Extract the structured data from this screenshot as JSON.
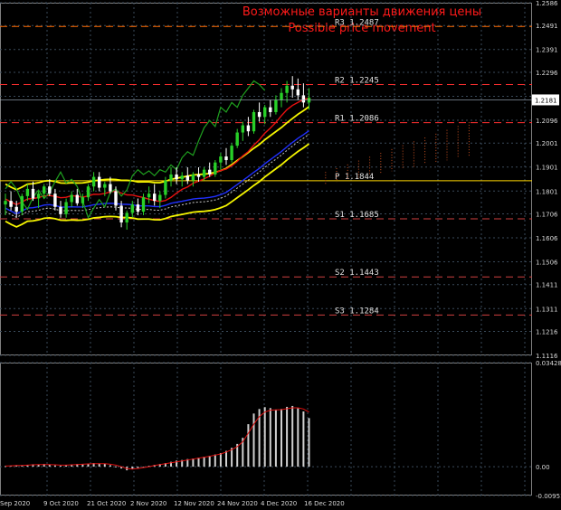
{
  "chart_data": {
    "type": "candlestick",
    "title": "Возможные варианты движения цены",
    "subtitle": "Possible price movement",
    "current_price_label": "1.2181",
    "price_axis": {
      "ticks": [
        "1.2586",
        "1.2491",
        "1.2391",
        "1.2296",
        "1.2196",
        "1.2096",
        "1.2001",
        "1.1901",
        "1.1801",
        "1.1706",
        "1.1606",
        "1.1506",
        "1.1411",
        "1.1311",
        "1.1216",
        "1.1116"
      ],
      "range": [
        1.1116,
        1.2586
      ]
    },
    "osc_axis": {
      "ticks": [
        "0.03428",
        "0.00",
        "-0.00951"
      ],
      "range": [
        -0.00951,
        0.03428
      ]
    },
    "x_axis_labels": [
      "Sep 2020",
      "9 Oct 2020",
      "21 Oct 2020",
      "2 Nov 2020",
      "12 Nov 2020",
      "24 Nov 2020",
      "4 Dec 2020",
      "16 Dec 2020"
    ],
    "pivot_levels": [
      {
        "name": "R3",
        "value": 1.2487,
        "label": "R3  1.2487",
        "color": "#ff6a00"
      },
      {
        "name": "R2",
        "value": 1.2245,
        "label": "R2  1.2245",
        "color": "#ff3030"
      },
      {
        "name": "R1",
        "value": 1.2086,
        "label": "R1  1.2086",
        "color": "#ff3030"
      },
      {
        "name": "P",
        "value": 1.1844,
        "label": "P  1.1844",
        "color": "#ffd700"
      },
      {
        "name": "S1",
        "value": 1.1685,
        "label": "S1  1.1685",
        "color": "#d04040"
      },
      {
        "name": "S2",
        "value": 1.1443,
        "label": "S2  1.1443",
        "color": "#d04040"
      },
      {
        "name": "S3",
        "value": 1.1284,
        "label": "S3  1.1284",
        "color": "#d04040"
      }
    ],
    "candles": [
      [
        1.1745,
        1.179,
        1.17,
        1.176
      ],
      [
        1.176,
        1.18,
        1.172,
        1.1735
      ],
      [
        1.1735,
        1.176,
        1.169,
        1.1715
      ],
      [
        1.1715,
        1.179,
        1.17,
        1.178
      ],
      [
        1.178,
        1.183,
        1.176,
        1.181
      ],
      [
        1.181,
        1.184,
        1.176,
        1.177
      ],
      [
        1.177,
        1.18,
        1.173,
        1.179
      ],
      [
        1.179,
        1.183,
        1.177,
        1.182
      ],
      [
        1.182,
        1.185,
        1.178,
        1.179
      ],
      [
        1.179,
        1.181,
        1.172,
        1.1735
      ],
      [
        1.1735,
        1.176,
        1.169,
        1.1705
      ],
      [
        1.1705,
        1.177,
        1.169,
        1.1755
      ],
      [
        1.1755,
        1.18,
        1.1735,
        1.1785
      ],
      [
        1.1785,
        1.181,
        1.174,
        1.175
      ],
      [
        1.175,
        1.179,
        1.173,
        1.1775
      ],
      [
        1.1775,
        1.183,
        1.176,
        1.182
      ],
      [
        1.182,
        1.188,
        1.18,
        1.186
      ],
      [
        1.186,
        1.188,
        1.18,
        1.1815
      ],
      [
        1.1815,
        1.184,
        1.178,
        1.183
      ],
      [
        1.183,
        1.186,
        1.179,
        1.18
      ],
      [
        1.18,
        1.182,
        1.172,
        1.174
      ],
      [
        1.174,
        1.176,
        1.165,
        1.167
      ],
      [
        1.167,
        1.172,
        1.164,
        1.171
      ],
      [
        1.171,
        1.176,
        1.169,
        1.1745
      ],
      [
        1.1745,
        1.177,
        1.17,
        1.1715
      ],
      [
        1.1715,
        1.179,
        1.17,
        1.1775
      ],
      [
        1.1775,
        1.182,
        1.175,
        1.179
      ],
      [
        1.179,
        1.183,
        1.174,
        1.176
      ],
      [
        1.176,
        1.18,
        1.173,
        1.1785
      ],
      [
        1.1785,
        1.186,
        1.177,
        1.1845
      ],
      [
        1.1845,
        1.19,
        1.182,
        1.187
      ],
      [
        1.187,
        1.19,
        1.183,
        1.185
      ],
      [
        1.185,
        1.188,
        1.182,
        1.1865
      ],
      [
        1.1865,
        1.19,
        1.183,
        1.1845
      ],
      [
        1.1845,
        1.188,
        1.182,
        1.187
      ],
      [
        1.187,
        1.19,
        1.184,
        1.186
      ],
      [
        1.186,
        1.19,
        1.1845,
        1.189
      ],
      [
        1.189,
        1.192,
        1.186,
        1.187
      ],
      [
        1.187,
        1.193,
        1.186,
        1.192
      ],
      [
        1.192,
        1.196,
        1.189,
        1.1945
      ],
      [
        1.1945,
        1.198,
        1.191,
        1.193
      ],
      [
        1.193,
        1.2,
        1.192,
        1.199
      ],
      [
        1.199,
        1.206,
        1.198,
        1.2045
      ],
      [
        1.2045,
        1.209,
        1.201,
        1.2075
      ],
      [
        1.2075,
        1.211,
        1.203,
        1.205
      ],
      [
        1.205,
        1.214,
        1.204,
        1.213
      ],
      [
        1.213,
        1.217,
        1.209,
        1.211
      ],
      [
        1.211,
        1.216,
        1.208,
        1.215
      ],
      [
        1.215,
        1.218,
        1.211,
        1.213
      ],
      [
        1.213,
        1.22,
        1.212,
        1.218
      ],
      [
        1.218,
        1.223,
        1.215,
        1.221
      ],
      [
        1.221,
        1.226,
        1.217,
        1.224
      ],
      [
        1.224,
        1.228,
        1.219,
        1.2225
      ],
      [
        1.2225,
        1.227,
        1.218,
        1.22
      ],
      [
        1.22,
        1.225,
        1.215,
        1.217
      ],
      [
        1.217,
        1.223,
        1.214,
        1.219
      ]
    ],
    "oscillator": {
      "histogram": [
        0.0002,
        0.0003,
        0.0005,
        0.0004,
        0.0006,
        0.0008,
        0.0007,
        0.0009,
        0.0006,
        0.0004,
        0.0003,
        0.0005,
        0.0007,
        0.0009,
        0.0008,
        0.001,
        0.0012,
        0.0011,
        0.0009,
        0.0005,
        0.0001,
        -0.0006,
        -0.0012,
        -0.0008,
        -0.0004,
        0.0,
        0.0003,
        0.0006,
        0.0009,
        0.0012,
        0.0016,
        0.002,
        0.0022,
        0.0025,
        0.0027,
        0.003,
        0.0033,
        0.0036,
        0.004,
        0.0045,
        0.0052,
        0.0062,
        0.0075,
        0.0095,
        0.014,
        0.0175,
        0.019,
        0.0196,
        0.0193,
        0.0188,
        0.019,
        0.0197,
        0.02,
        0.0192,
        0.0182,
        0.016
      ],
      "signal": [
        0.0002,
        0.0003,
        0.0004,
        0.0004,
        0.0005,
        0.0006,
        0.0007,
        0.0007,
        0.0007,
        0.0006,
        0.0005,
        0.0005,
        0.0006,
        0.0007,
        0.0008,
        0.0009,
        0.001,
        0.001,
        0.001,
        0.0008,
        0.0005,
        0.0,
        -0.0006,
        -0.0008,
        -0.0006,
        -0.0003,
        0.0,
        0.0004,
        0.0007,
        0.001,
        0.0013,
        0.0016,
        0.0019,
        0.0022,
        0.0025,
        0.0028,
        0.0031,
        0.0034,
        0.0038,
        0.0042,
        0.0048,
        0.0056,
        0.0066,
        0.0082,
        0.011,
        0.014,
        0.0165,
        0.018,
        0.0186,
        0.0187,
        0.0188,
        0.0191,
        0.0194,
        0.0194,
        0.019,
        0.018
      ]
    }
  }
}
